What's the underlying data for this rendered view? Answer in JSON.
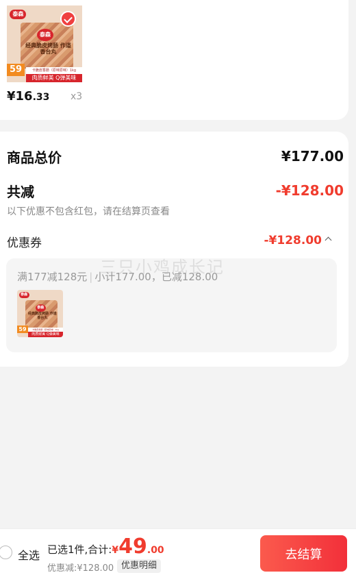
{
  "product": {
    "brand": "泰森",
    "bag_text": "经典脆皮烤肠 作道香台丸",
    "price_tag": "59",
    "strip_text": "肉质鲜美 Q弹美味",
    "small_strip": "卡脆皮香肠（原味原味）1kg",
    "unit_price_main": "¥16",
    "unit_price_dec": ".33",
    "quantity": "x3",
    "selected": true
  },
  "summary": {
    "total_label": "商品总价",
    "total_value": "¥177.00",
    "reduce_label": "共减",
    "reduce_value": "-¥128.00",
    "note": "以下优惠不包含红包，请在结算页查看",
    "coupon_label": "优惠券",
    "coupon_value": "-¥128.00",
    "coupon_rule": "满177减128元",
    "coupon_detail": "小计177.00，已减128.00",
    "watermark": "三只小鸡成长记"
  },
  "bottom": {
    "select_all": "全选",
    "selected_text": "已选1件,合计:",
    "yen": "¥",
    "amount_int": "49",
    "amount_dec": ".00",
    "saving": "优惠减:¥128.00",
    "detail_btn": "优惠明细",
    "checkout": "去结算"
  },
  "colors": {
    "accent": "#f03c2e",
    "checkout_start": "#fb5a4d",
    "checkout_end": "#f2303a"
  }
}
